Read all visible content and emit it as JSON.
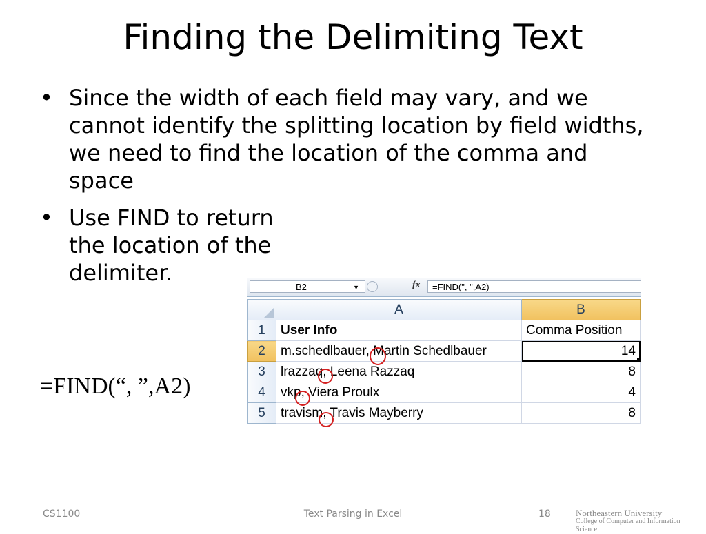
{
  "slide": {
    "title": "Finding the Delimiting Text",
    "bullets": [
      "Since the width of each field may vary, and we cannot identify the splitting location by field widths, we need to find the location of the comma and space",
      "Use FIND to return the location of the delimiter."
    ],
    "formula": "=FIND(“, ”,A2)"
  },
  "excel": {
    "name_box": "B2",
    "fx_symbol": "fx",
    "formula_bar": "=FIND(\", \",A2)",
    "columns": [
      "A",
      "B"
    ],
    "rows": [
      {
        "num": "1",
        "a": "User Info",
        "b": "Comma Position"
      },
      {
        "num": "2",
        "a": "m.schedlbauer, Martin Schedlbauer",
        "b": "14"
      },
      {
        "num": "3",
        "a": "lrazzaq, Leena Razzaq",
        "b": "8"
      },
      {
        "num": "4",
        "a": "vkp, Viera Proulx",
        "b": "4"
      },
      {
        "num": "5",
        "a": "travism, Travis Mayberry",
        "b": "8"
      }
    ],
    "annotation_color": "#d42020",
    "selection_color": "#f1c15f"
  },
  "footer": {
    "course": "CS1100",
    "topic": "Text Parsing in Excel",
    "page": "18",
    "logo_line1": "Northeastern University",
    "logo_line2": "College of Computer and Information Science"
  }
}
